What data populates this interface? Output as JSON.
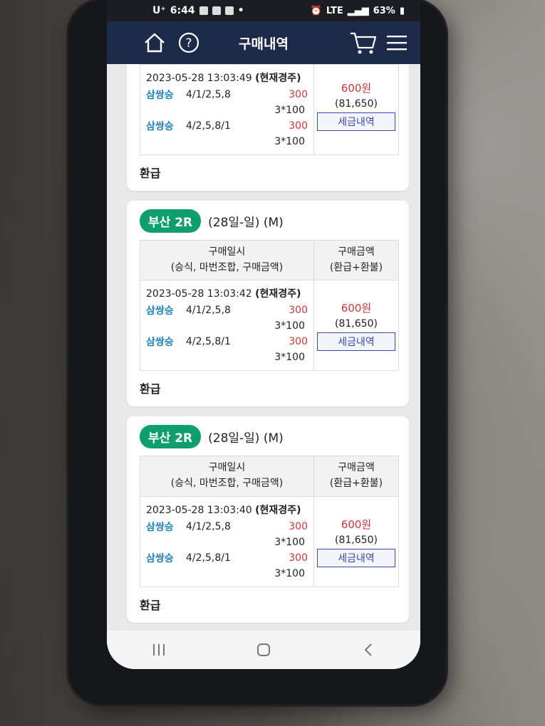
{
  "status_bar": {
    "carrier": "U⁺",
    "time": "6:44",
    "network": "LTE",
    "battery": "63%"
  },
  "app_bar": {
    "title": "구매내역"
  },
  "table_headers": {
    "left_line1": "구매일시",
    "left_line2": "(승식, 마번조합, 구매금액)",
    "right_line1": "구매금액",
    "right_line2": "(환급+환불)"
  },
  "first_card": {
    "timestamp": "2023-05-28 13:03:49",
    "timestamp_suffix": "(현재경주)",
    "bets": [
      {
        "type": "삼쌍승",
        "combo": "4/1/2,5,8",
        "amount": "300",
        "multiplier": "3*100"
      },
      {
        "type": "삼쌍승",
        "combo": "4/2,5,8/1",
        "amount": "300",
        "multiplier": "3*100"
      }
    ],
    "price": "600원",
    "sub_amount": "(81,650)",
    "tax_button": "세금내역",
    "refund_label": "환급"
  },
  "cards": [
    {
      "race": "부산 2R",
      "date": "(28일-일) (M)",
      "timestamp": "2023-05-28 13:03:42",
      "timestamp_suffix": "(현재경주)",
      "bets": [
        {
          "type": "삼쌍승",
          "combo": "4/1/2,5,8",
          "amount": "300",
          "multiplier": "3*100"
        },
        {
          "type": "삼쌍승",
          "combo": "4/2,5,8/1",
          "amount": "300",
          "multiplier": "3*100"
        }
      ],
      "price": "600원",
      "sub_amount": "(81,650)",
      "tax_button": "세금내역",
      "refund_label": "환급"
    },
    {
      "race": "부산 2R",
      "date": "(28일-일) (M)",
      "timestamp": "2023-05-28 13:03:40",
      "timestamp_suffix": "(현재경주)",
      "bets": [
        {
          "type": "삼쌍승",
          "combo": "4/1/2,5,8",
          "amount": "300",
          "multiplier": "3*100"
        },
        {
          "type": "삼쌍승",
          "combo": "4/2,5,8/1",
          "amount": "300",
          "multiplier": "3*100"
        }
      ],
      "price": "600원",
      "sub_amount": "(81,650)",
      "tax_button": "세금내역",
      "refund_label": "환급"
    }
  ],
  "colors": {
    "header_bg": "#1d2a4a",
    "badge_green": "#0f9e6e",
    "bet_type_blue": "#1d86b8",
    "amount_red": "#d23434",
    "tax_button_border": "#3b46b8"
  },
  "icons": {
    "home": "home-icon",
    "help": "help-icon",
    "cart": "cart-icon",
    "menu": "hamburger-menu-icon"
  }
}
